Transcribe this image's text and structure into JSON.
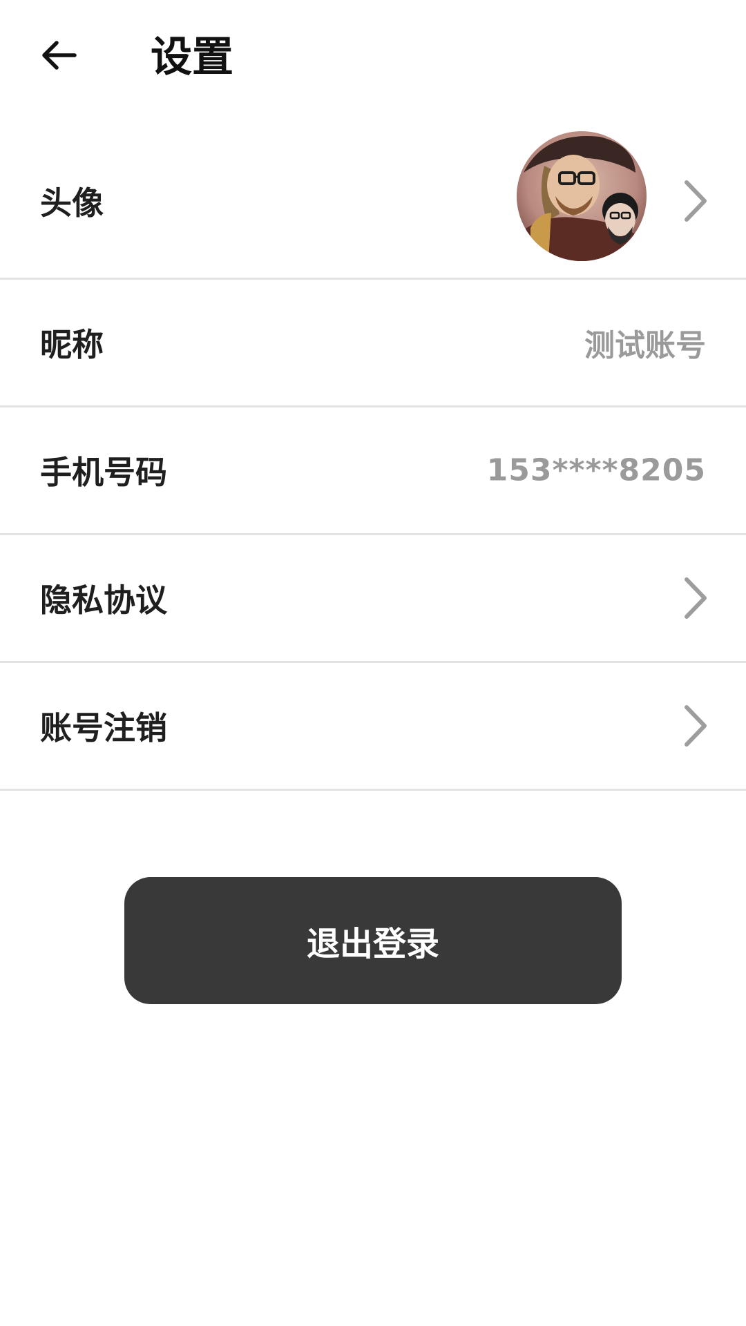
{
  "header": {
    "back_icon": "arrow-left-icon",
    "title": "设置"
  },
  "settings": {
    "avatar": {
      "label": "头像",
      "icon": "chevron-right-icon"
    },
    "nickname": {
      "label": "昵称",
      "value": "测试账号"
    },
    "phone": {
      "label": "手机号码",
      "value": "153****8205"
    },
    "privacy": {
      "label": "隐私协议",
      "icon": "chevron-right-icon"
    },
    "delete_account": {
      "label": "账号注销",
      "icon": "chevron-right-icon"
    }
  },
  "logout": {
    "label": "退出登录"
  },
  "colors": {
    "button_bg": "#3a393a",
    "divider": "#e3e3e3",
    "secondary_text": "#9a9a9a",
    "chevron": "#9d9d9d"
  }
}
